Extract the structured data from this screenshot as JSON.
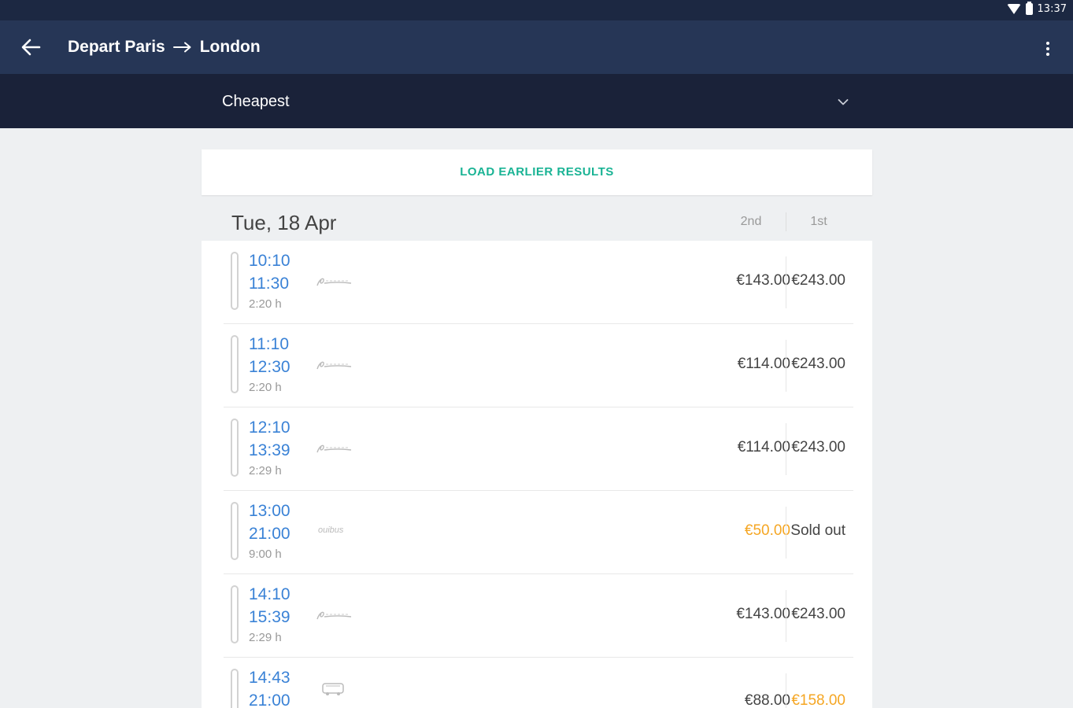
{
  "status_bar": {
    "time": "13:37",
    "wifi_icon": "wifi-icon",
    "battery_icon": "battery-icon"
  },
  "app_bar": {
    "back_icon": "arrow-left-icon",
    "title_depart": "Depart Paris",
    "title_arrow": "arrow-right-icon",
    "title_destination": "London",
    "menu_icon": "more-vertical-icon"
  },
  "sort": {
    "selected": "Cheapest",
    "icon": "chevron-down-icon"
  },
  "load_earlier": "LOAD EARLIER RESULTS",
  "date_header": {
    "date": "Tue, 18 Apr",
    "col_2nd": "2nd",
    "col_1st": "1st"
  },
  "colors": {
    "accent": "#19b394",
    "time_blue": "#3a82d6",
    "highlight_orange": "#f5a623",
    "app_bar": "#263656",
    "sort_bar": "#1a2239"
  },
  "journeys": [
    {
      "depart": "10:10",
      "arrive": "11:30",
      "duration": "2:20 h",
      "carrier": "eurostar-logo",
      "price_2nd": "€143.00",
      "price_1st": "€243.00"
    },
    {
      "depart": "11:10",
      "arrive": "12:30",
      "duration": "2:20 h",
      "carrier": "eurostar-logo",
      "price_2nd": "€114.00",
      "price_1st": "€243.00"
    },
    {
      "depart": "12:10",
      "arrive": "13:39",
      "duration": "2:29 h",
      "carrier": "eurostar-logo",
      "price_2nd": "€114.00",
      "price_1st": "€243.00"
    },
    {
      "depart": "13:00",
      "arrive": "21:00",
      "duration": "9:00 h",
      "carrier": "ouibus-logo",
      "carrier_text": "ouibus",
      "price_2nd": "€50.00",
      "price_1st": "Sold out",
      "price_2nd_highlight": true
    },
    {
      "depart": "14:10",
      "arrive": "15:39",
      "duration": "2:29 h",
      "carrier": "eurostar-logo",
      "price_2nd": "€143.00",
      "price_1st": "€243.00"
    },
    {
      "depart": "14:43",
      "arrive": "21:00",
      "duration": "",
      "carrier": "bus-icon",
      "price_2nd": "€88.00",
      "price_1st": "€158.00",
      "price_1st_highlight": true
    }
  ]
}
